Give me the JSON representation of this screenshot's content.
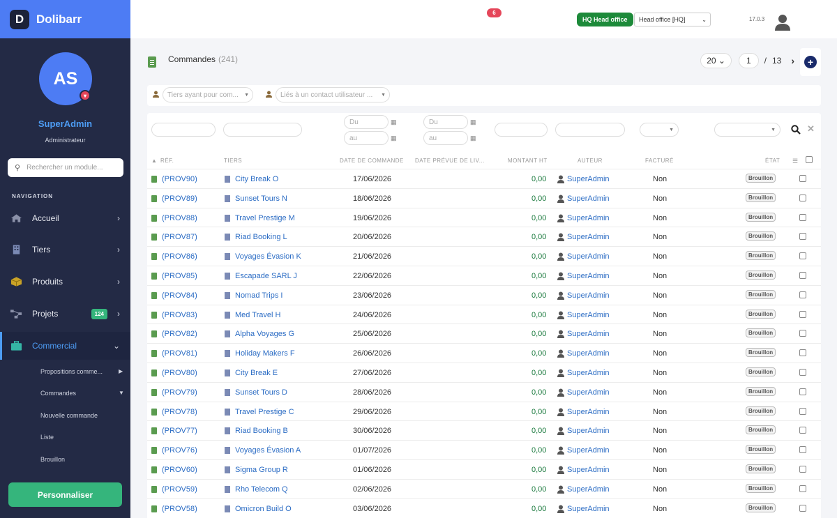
{
  "app": {
    "logo_letter": "D",
    "name": "Dolibarr"
  },
  "user": {
    "initials": "AS",
    "name": "SuperAdmin",
    "role": "Administrateur"
  },
  "sidebar": {
    "search_placeholder": "Rechercher un module...",
    "nav_title": "NAVIGATION",
    "items": [
      {
        "label": "Accueil",
        "icon": "home-icon"
      },
      {
        "label": "Tiers",
        "icon": "building-icon"
      },
      {
        "label": "Produits",
        "icon": "box-icon"
      },
      {
        "label": "Projets",
        "icon": "project-icon",
        "badge": "124"
      },
      {
        "label": "Commercial",
        "icon": "briefcase-icon"
      }
    ],
    "sub_items": [
      "Propositions comme...",
      "Commandes",
      "Nouvelle commande",
      "Liste",
      "Brouillon"
    ],
    "personalize": "Personnaliser"
  },
  "topbar": {
    "notifications": "6",
    "entity_badge": "HQ Head office",
    "entity_select": "Head office [HQ]",
    "version": "17.0.3"
  },
  "page": {
    "title": "Commandes",
    "count": "(241)",
    "limit": "20",
    "page": "1",
    "page_sep": "/",
    "total_pages": "13"
  },
  "filters": {
    "thirdparty": "Tiers ayant pour com...",
    "contact": "Liés à un contact utilisateur ...",
    "du": "Du",
    "au": "au"
  },
  "columns": [
    "RÉF.",
    "TIERS",
    "DATE DE COMMANDE",
    "DATE PRÉVUE DE LIV...",
    "MONTANT HT",
    "AUTEUR",
    "FACTURÉ",
    "ÉTAT"
  ],
  "rows": [
    {
      "ref": "(PROV90)",
      "tiers": "City Break O",
      "date": "17/06/2026",
      "amount": "0,00",
      "author": "SuperAdmin",
      "billed": "Non",
      "status": "Brouillon"
    },
    {
      "ref": "(PROV89)",
      "tiers": "Sunset Tours N",
      "date": "18/06/2026",
      "amount": "0,00",
      "author": "SuperAdmin",
      "billed": "Non",
      "status": "Brouillon"
    },
    {
      "ref": "(PROV88)",
      "tiers": "Travel Prestige M",
      "date": "19/06/2026",
      "amount": "0,00",
      "author": "SuperAdmin",
      "billed": "Non",
      "status": "Brouillon"
    },
    {
      "ref": "(PROV87)",
      "tiers": "Riad Booking L",
      "date": "20/06/2026",
      "amount": "0,00",
      "author": "SuperAdmin",
      "billed": "Non",
      "status": "Brouillon"
    },
    {
      "ref": "(PROV86)",
      "tiers": "Voyages Évasion K",
      "date": "21/06/2026",
      "amount": "0,00",
      "author": "SuperAdmin",
      "billed": "Non",
      "status": "Brouillon"
    },
    {
      "ref": "(PROV85)",
      "tiers": "Escapade SARL J",
      "date": "22/06/2026",
      "amount": "0,00",
      "author": "SuperAdmin",
      "billed": "Non",
      "status": "Brouillon"
    },
    {
      "ref": "(PROV84)",
      "tiers": "Nomad Trips I",
      "date": "23/06/2026",
      "amount": "0,00",
      "author": "SuperAdmin",
      "billed": "Non",
      "status": "Brouillon"
    },
    {
      "ref": "(PROV83)",
      "tiers": "Med Travel H",
      "date": "24/06/2026",
      "amount": "0,00",
      "author": "SuperAdmin",
      "billed": "Non",
      "status": "Brouillon"
    },
    {
      "ref": "(PROV82)",
      "tiers": "Alpha Voyages G",
      "date": "25/06/2026",
      "amount": "0,00",
      "author": "SuperAdmin",
      "billed": "Non",
      "status": "Brouillon"
    },
    {
      "ref": "(PROV81)",
      "tiers": "Holiday Makers F",
      "date": "26/06/2026",
      "amount": "0,00",
      "author": "SuperAdmin",
      "billed": "Non",
      "status": "Brouillon"
    },
    {
      "ref": "(PROV80)",
      "tiers": "City Break E",
      "date": "27/06/2026",
      "amount": "0,00",
      "author": "SuperAdmin",
      "billed": "Non",
      "status": "Brouillon"
    },
    {
      "ref": "(PROV79)",
      "tiers": "Sunset Tours D",
      "date": "28/06/2026",
      "amount": "0,00",
      "author": "SuperAdmin",
      "billed": "Non",
      "status": "Brouillon"
    },
    {
      "ref": "(PROV78)",
      "tiers": "Travel Prestige C",
      "date": "29/06/2026",
      "amount": "0,00",
      "author": "SuperAdmin",
      "billed": "Non",
      "status": "Brouillon"
    },
    {
      "ref": "(PROV77)",
      "tiers": "Riad Booking B",
      "date": "30/06/2026",
      "amount": "0,00",
      "author": "SuperAdmin",
      "billed": "Non",
      "status": "Brouillon"
    },
    {
      "ref": "(PROV76)",
      "tiers": "Voyages Évasion A",
      "date": "01/07/2026",
      "amount": "0,00",
      "author": "SuperAdmin",
      "billed": "Non",
      "status": "Brouillon"
    },
    {
      "ref": "(PROV60)",
      "tiers": "Sigma Group R",
      "date": "01/06/2026",
      "amount": "0,00",
      "author": "SuperAdmin",
      "billed": "Non",
      "status": "Brouillon"
    },
    {
      "ref": "(PROV59)",
      "tiers": "Rho Telecom Q",
      "date": "02/06/2026",
      "amount": "0,00",
      "author": "SuperAdmin",
      "billed": "Non",
      "status": "Brouillon"
    },
    {
      "ref": "(PROV58)",
      "tiers": "Omicron Build O",
      "date": "03/06/2026",
      "amount": "0,00",
      "author": "SuperAdmin",
      "billed": "Non",
      "status": "Brouillon"
    }
  ],
  "colors": {
    "accent": "#4d7cf4",
    "sidebar_bg": "#232a45",
    "success": "#35b57c",
    "link": "#2b6cc4"
  }
}
